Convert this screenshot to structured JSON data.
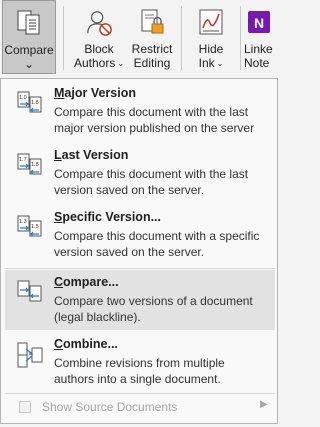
{
  "ribbon": {
    "compare": {
      "label": "Compare",
      "icon": "compare-document-icon"
    },
    "block": {
      "line1": "Block",
      "line2": "Authors",
      "icon": "block-authors-icon"
    },
    "restrict": {
      "line1": "Restrict",
      "line2": "Editing",
      "icon": "restrict-editing-icon"
    },
    "hide": {
      "line1": "Hide",
      "line2": "Ink",
      "icon": "hide-ink-icon"
    },
    "linked": {
      "line1": "Linke",
      "line2": "Note",
      "icon": "onenote-icon",
      "icon_text": "N",
      "icon_color": "#7719aa"
    },
    "caret": "⌄"
  },
  "menu": {
    "items": [
      {
        "title_first": "M",
        "title_rest": "ajor Version",
        "desc": "Compare this document with the last major version published on the server",
        "icon": "major-version-icon",
        "badge_top": "1.0",
        "badge_bottom": "1.8"
      },
      {
        "title_first": "L",
        "title_rest": "ast Version",
        "desc": "Compare this document with the last version saved on the server.",
        "icon": "last-version-icon",
        "badge_top": "1.7",
        "badge_bottom": "1.8"
      },
      {
        "title_first": "S",
        "title_rest": "pecific Version...",
        "desc": "Compare this document with a specific version saved on the server.",
        "icon": "specific-version-icon",
        "badge_top": "1.3",
        "badge_bottom": "1.5"
      },
      {
        "title_first": "C",
        "title_rest": "ompare...",
        "desc": "Compare two versions of a document (legal blackline).",
        "icon": "compare-icon"
      },
      {
        "title_first": "C",
        "title_rest": "ombine...",
        "desc": "Combine revisions from multiple authors into a single document.",
        "icon": "combine-icon"
      }
    ],
    "footer": {
      "label": "Show Source Documents",
      "arrow": "▶"
    }
  },
  "colors": {
    "accent_blue": "#2b79c2",
    "hover_bg": "#e2e2e2",
    "disabled_text": "#a5a5a5",
    "onenote_purple": "#7719aa"
  }
}
